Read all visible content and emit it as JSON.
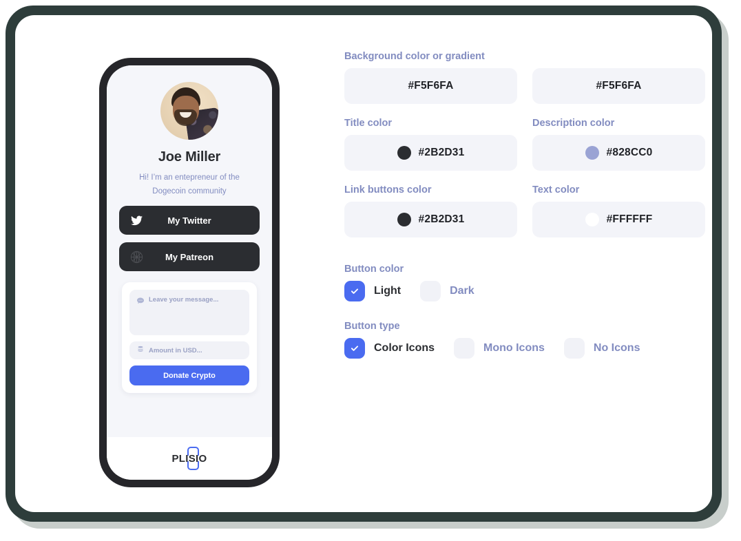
{
  "preview": {
    "profile": {
      "avatar_alt": "avatar",
      "name": "Joe Miller",
      "bio": "Hi! I’m an entepreneur of the Dogecoin community"
    },
    "links": [
      {
        "icon": "twitter-icon",
        "label": "My Twitter"
      },
      {
        "icon": "patreon-icon",
        "label": "My Patreon"
      }
    ],
    "donation": {
      "message_placeholder": "Leave your message...",
      "message_icon": "chat-bubble-icon",
      "amount_placeholder": "Amount in USD...",
      "amount_icon": "coins-icon",
      "donate_label": "Donate Crypto"
    },
    "footer": {
      "brand": "PLISIO"
    }
  },
  "settings": {
    "background": {
      "label": "Background color or gradient",
      "start_value": "#F5F6FA",
      "end_value": "#F5F6FA"
    },
    "title_color": {
      "label": "Title color",
      "value": "#2B2D31",
      "swatch": "#2B2D31"
    },
    "description_color": {
      "label": "Description color",
      "value": "#828CC0",
      "swatch": "#828CC0"
    },
    "link_buttons_color": {
      "label": "Link buttons color",
      "value": "#2B2D31",
      "swatch": "#2B2D31"
    },
    "text_color": {
      "label": "Text color",
      "value": "#FFFFFF",
      "swatch": "#FFFFFF"
    },
    "button_color": {
      "label": "Button color",
      "options": [
        {
          "label": "Light",
          "checked": true
        },
        {
          "label": "Dark",
          "checked": false
        }
      ]
    },
    "button_type": {
      "label": "Button type",
      "options": [
        {
          "label": "Color Icons",
          "checked": true
        },
        {
          "label": "Mono Icons",
          "checked": false
        },
        {
          "label": "No Icons",
          "checked": false
        }
      ]
    }
  },
  "theme": {
    "accent": "#4A6BF0",
    "label_color": "#828CC0",
    "dark": "#2B2D31",
    "field_bg": "#F3F4F9",
    "frame": "#2E3D3B"
  }
}
